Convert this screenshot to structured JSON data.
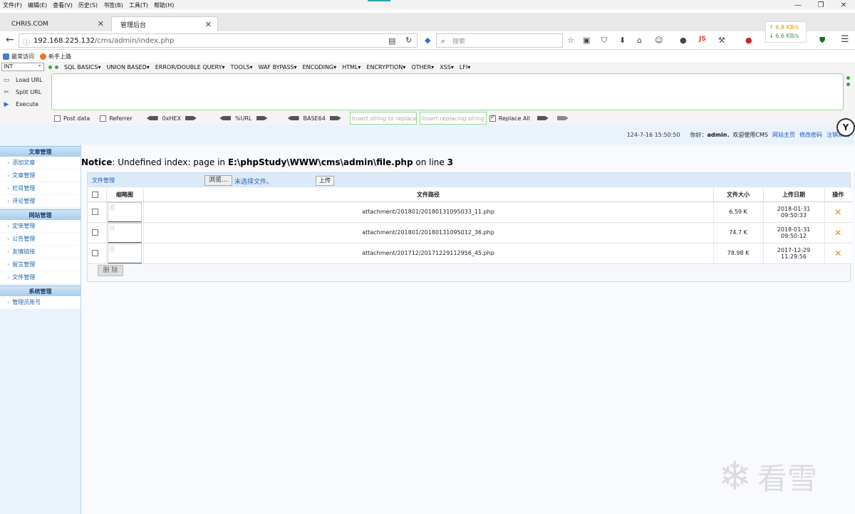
{
  "menubar": [
    "文件(F)",
    "编辑(E)",
    "查看(V)",
    "历史(S)",
    "书签(B)",
    "工具(T)",
    "帮助(H)"
  ],
  "window_controls": [
    "—",
    "❐",
    "✕"
  ],
  "tabs": [
    {
      "label": "CHRIS.COM",
      "active": false
    },
    {
      "label": "管理后台",
      "active": true
    }
  ],
  "navbar": {
    "url_host": "192.168.225.132",
    "url_path": "/cms/admin/index.php",
    "search_placeholder": "搜索"
  },
  "netspeed": {
    "up": "↑ 6.8 KB/s",
    "down": "↓ 6.6 KB/s"
  },
  "bookmarks": [
    "最常访问",
    "新手上路"
  ],
  "hackbar": {
    "select_value": "INT",
    "menus": [
      "SQL BASICS▾",
      "UNION BASED▾",
      "ERROR/DOUBLE QUERY▾",
      "TOOLS▾",
      "WAF BYPASS▾",
      "ENCODING▾",
      "HTML▾",
      "ENCRYPTION▾",
      "OTHER▾",
      "XSS▾",
      "LFI▾"
    ],
    "actions": [
      "Load URL",
      "Split URL",
      "Execute"
    ],
    "post_data": "Post data",
    "referrer": "Referrer",
    "hex": "0xHEX",
    "url": "%URL",
    "base64": "BASE64",
    "insert_placeholder": "Insert string to replace",
    "replacing_placeholder": "Insert replacing string",
    "replace_all": "Replace All"
  },
  "topinfo": {
    "datetime": "124-7-16 15:50:50",
    "hello_prefix": "你好：",
    "user": "admin",
    "hello_suffix": "，欢迎使用CMS",
    "links": [
      "网站主页",
      "修改密码",
      "注销系统"
    ]
  },
  "sidebar": [
    {
      "group": "文章管理",
      "items": [
        "添加文章",
        "文章管理",
        "栏目管理",
        "评论管理"
      ]
    },
    {
      "group": "网站管理",
      "items": [
        "定单管理",
        "公告管理",
        "友情链接",
        "留言管理",
        "文件管理"
      ]
    },
    {
      "group": "系统管理",
      "items": [
        "管理员账号"
      ]
    }
  ],
  "notice": {
    "label": "Notice",
    "text": ": Undefined index: page in ",
    "file": "E:\\phpStudy\\WWW\\cms\\admin\\file.php",
    "line_text": " on line ",
    "line": "3"
  },
  "panel": {
    "title": "文件管理",
    "browse": "浏览...",
    "no_file": "未选择文件。",
    "upload": "上传",
    "columns": [
      "",
      "缩略图",
      "文件路径",
      "文件大小",
      "上传日期",
      "操作"
    ],
    "rows": [
      {
        "path": "attachment/201801/20180131095033_11.php",
        "size": "6.59 K",
        "date": "2018-01-31",
        "time": "09:50:33"
      },
      {
        "path": "attachment/201801/20180131095012_36.php",
        "size": "74.7 K",
        "date": "2018-01-31",
        "time": "09:50:12"
      },
      {
        "path": "attachment/201712/20171229112956_45.php",
        "size": "78.98 K",
        "date": "2017-12-29",
        "time": "11:29:56"
      }
    ],
    "delete_button": "删 除"
  },
  "watermark": "看雪"
}
